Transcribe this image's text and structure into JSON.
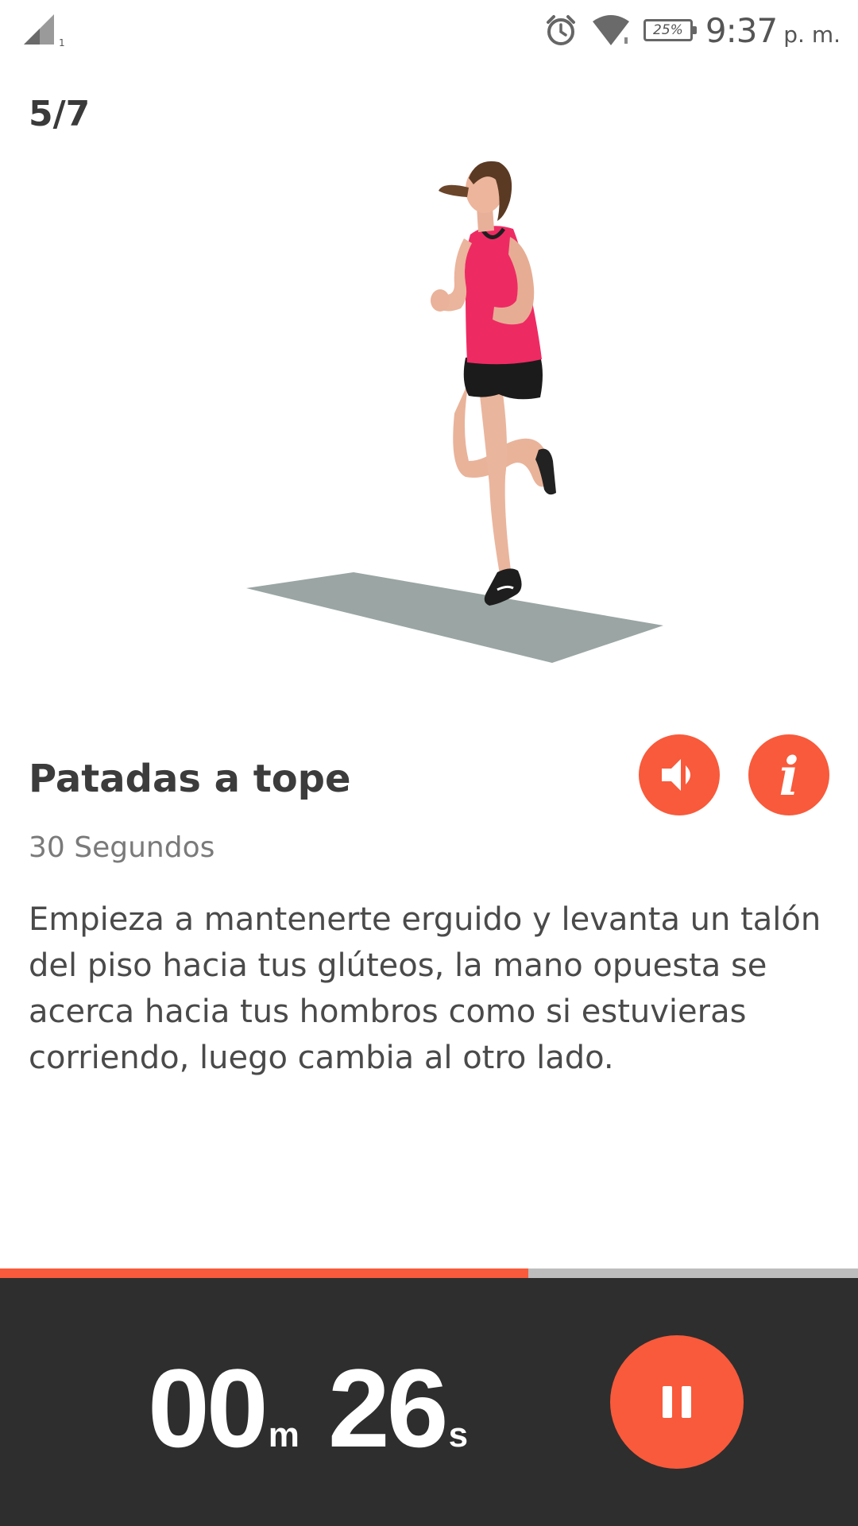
{
  "status_bar": {
    "sim_label": "1",
    "battery_label": "25%",
    "time": "9:37",
    "ampm": "p. m."
  },
  "workout": {
    "step_counter": "5/7",
    "progress_fraction": 0.616
  },
  "exercise": {
    "title": "Patadas a tope",
    "duration": "30 Segundos",
    "description": "Empieza a mantenerte erguido y levanta un talón del piso hacia tus glúteos, la mano opuesta se acerca hacia tus hombros como si estuvieras corriendo, luego cambia al otro lado.",
    "info_glyph": "i"
  },
  "timer": {
    "minutes": "00",
    "minutes_unit": "m",
    "seconds": "26",
    "seconds_unit": "s"
  },
  "icons": {
    "sound": "speaker-icon",
    "info": "info-icon",
    "pause": "pause-icon",
    "alarm": "alarm-icon",
    "wifi": "wifi-icon",
    "signal": "cell-signal-icon",
    "battery": "battery-icon"
  },
  "colors": {
    "accent": "#f85a3b",
    "bottom_bar": "#2e2e2e",
    "progress_track": "#bdbdbd",
    "shirt": "#ee2a63",
    "mat": "#9aa5a4"
  }
}
